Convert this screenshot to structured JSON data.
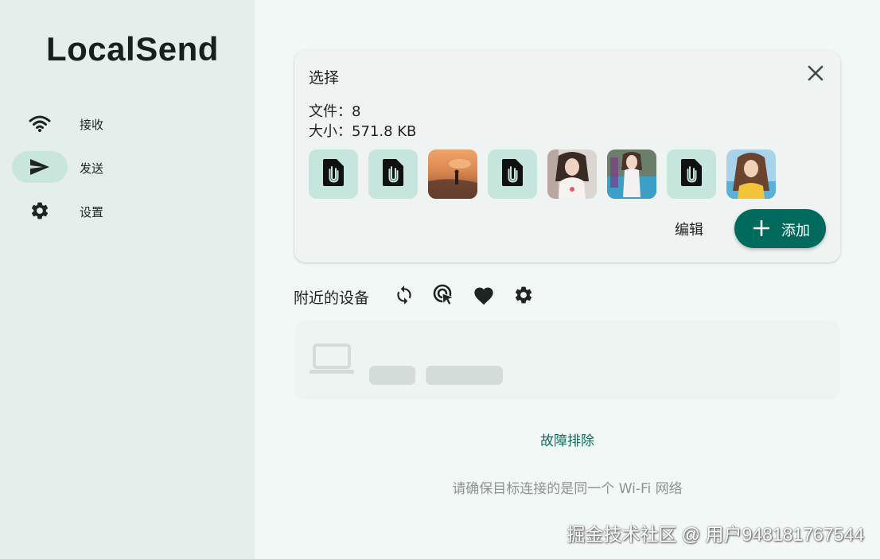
{
  "app": {
    "title": "LocalSend"
  },
  "sidebar": {
    "items": [
      {
        "label": "接收",
        "icon": "wifi-icon",
        "active": false
      },
      {
        "label": "发送",
        "icon": "send-icon",
        "active": true
      },
      {
        "label": "设置",
        "icon": "gear-icon",
        "active": false
      }
    ]
  },
  "selection": {
    "title": "选择",
    "files_line": "文件：8",
    "size_line": "大小：571.8 KB",
    "thumbnails": [
      {
        "kind": "file",
        "icon": "file-attachment-icon"
      },
      {
        "kind": "file",
        "icon": "file-attachment-icon"
      },
      {
        "kind": "image",
        "desc": "sunset-photo"
      },
      {
        "kind": "file",
        "icon": "file-attachment-icon"
      },
      {
        "kind": "image",
        "desc": "portrait-photo"
      },
      {
        "kind": "image",
        "desc": "portrait-photo"
      },
      {
        "kind": "file",
        "icon": "file-attachment-icon"
      },
      {
        "kind": "image",
        "desc": "portrait-photo"
      }
    ],
    "edit_label": "编辑",
    "add_label": "添加"
  },
  "nearby": {
    "title": "附近的设备",
    "tools": [
      "refresh-icon",
      "target-cursor-icon",
      "favorite-heart-icon",
      "gear-icon"
    ]
  },
  "links": {
    "troubleshoot": "故障排除",
    "hint": "请确保目标连接的是同一个 Wi-Fi 网络"
  },
  "watermark": "掘金技术社区 @ 用户948181767544",
  "colors": {
    "accent": "#006b5d",
    "sidebar_bg": "#e4efeb",
    "page_bg": "#f1f8f6",
    "file_tile": "#c6e5dc",
    "active_pill": "#c9e6dd"
  }
}
